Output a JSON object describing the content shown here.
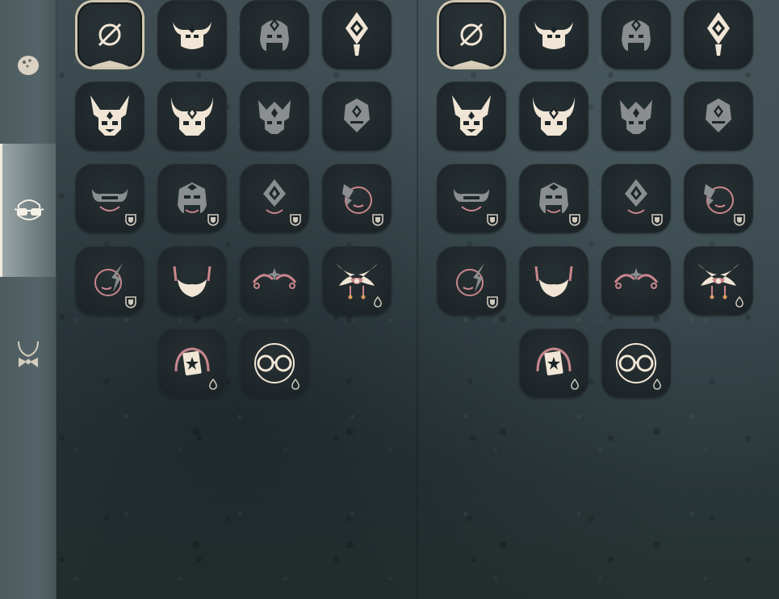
{
  "sidebar": {
    "tabs": [
      {
        "id": "tab-hairstyle",
        "icon": "hair-accessory-icon",
        "active": false
      },
      {
        "id": "tab-face",
        "icon": "glasses-face-icon",
        "active": true
      },
      {
        "id": "tab-neck",
        "icon": "bowtie-neck-icon",
        "active": false
      }
    ]
  },
  "grid": {
    "rows": [
      [
        {
          "icon": "none-icon",
          "state": "selected",
          "badge": null
        },
        {
          "icon": "bull-horns-mask-icon",
          "state": "owned",
          "badge": null
        },
        {
          "icon": "gem-helm-mask-icon",
          "state": "dim",
          "badge": null
        },
        {
          "icon": "diamond-crest-mask-icon",
          "state": "owned",
          "badge": null
        }
      ],
      [
        {
          "icon": "horned-demon-mask-icon",
          "state": "owned",
          "badge": null
        },
        {
          "icon": "ox-demon-mask-icon",
          "state": "owned",
          "badge": null
        },
        {
          "icon": "crowned-beast-mask-icon",
          "state": "dim",
          "badge": null
        },
        {
          "icon": "shield-crest-mask-icon",
          "state": "dim",
          "badge": null
        }
      ],
      [
        {
          "icon": "horned-visor-icon",
          "state": "dim",
          "badge": "shield"
        },
        {
          "icon": "knight-helm-icon",
          "state": "dim",
          "badge": "shield"
        },
        {
          "icon": "diamond-veil-icon",
          "state": "dim",
          "badge": "shield"
        },
        {
          "icon": "spirit-face-icon",
          "state": "dim",
          "badge": "shield"
        }
      ],
      [
        {
          "icon": "flame-spirit-icon",
          "state": "dim",
          "badge": "shield"
        },
        {
          "icon": "mustache-beard-icon",
          "state": "owned",
          "badge": null
        },
        {
          "icon": "star-brows-icon",
          "state": "dim",
          "badge": null
        },
        {
          "icon": "winged-ornament-icon",
          "state": "owned",
          "badge": "drop"
        }
      ],
      [
        null,
        {
          "icon": "card-earmuffs-icon",
          "state": "owned",
          "badge": "drop"
        },
        {
          "icon": "round-glasses-icon",
          "state": "owned",
          "badge": "drop"
        },
        null
      ]
    ]
  },
  "colors": {
    "cream": "#f1e6d6",
    "dim": "#8a8e8f",
    "pink": "#c9868d",
    "tile": "#1e2629",
    "badge": "#cfc9bd"
  }
}
